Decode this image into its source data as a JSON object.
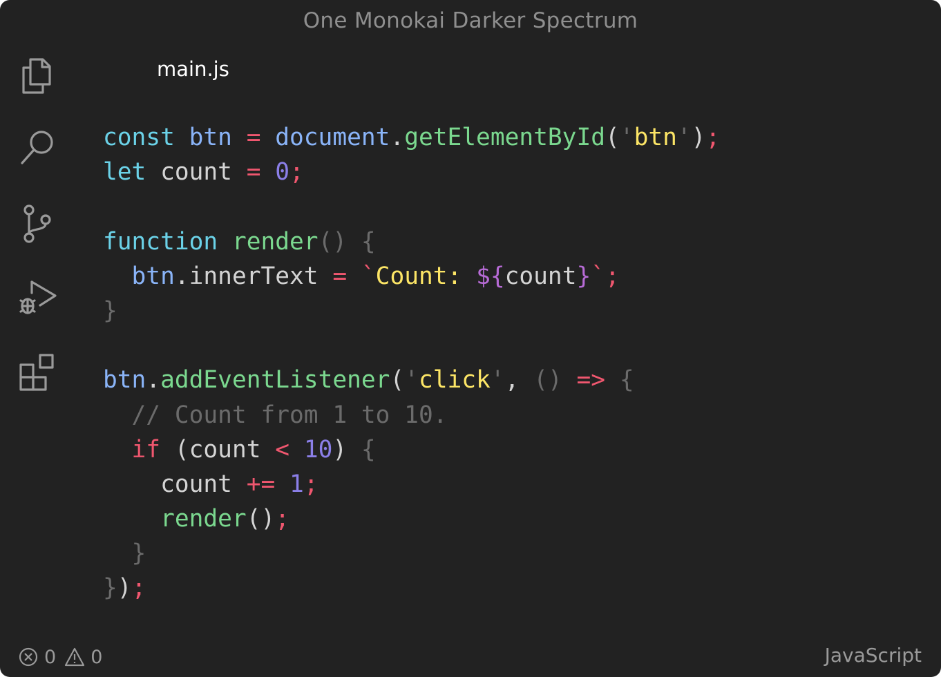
{
  "window": {
    "title": "One Monokai Darker Spectrum"
  },
  "activity_bar": {
    "icons": [
      "files-icon",
      "search-icon",
      "source-control-icon",
      "run-debug-icon",
      "extensions-icon"
    ]
  },
  "tab": {
    "label": "main.js"
  },
  "code": {
    "language": "JavaScript",
    "lines": [
      [
        {
          "t": "const ",
          "c": "kw-b"
        },
        {
          "t": "btn",
          "c": "var"
        },
        {
          "t": " = ",
          "c": "op"
        },
        {
          "t": "document",
          "c": "var"
        },
        {
          "t": ".",
          "c": "pun"
        },
        {
          "t": "getElementById",
          "c": "fn"
        },
        {
          "t": "(",
          "c": "pun"
        },
        {
          "t": "'",
          "c": "gry"
        },
        {
          "t": "btn",
          "c": "str"
        },
        {
          "t": "'",
          "c": "gry"
        },
        {
          "t": ")",
          "c": "pun"
        },
        {
          "t": ";",
          "c": "op"
        }
      ],
      [
        {
          "t": "let ",
          "c": "kw-b"
        },
        {
          "t": "count",
          "c": "plain"
        },
        {
          "t": " = ",
          "c": "op"
        },
        {
          "t": "0",
          "c": "num"
        },
        {
          "t": ";",
          "c": "op"
        }
      ],
      [],
      [
        {
          "t": "function ",
          "c": "kw-b"
        },
        {
          "t": "render",
          "c": "fn"
        },
        {
          "t": "() {",
          "c": "gry"
        }
      ],
      [
        {
          "t": "  btn",
          "c": "var"
        },
        {
          "t": ".",
          "c": "pun"
        },
        {
          "t": "innerText",
          "c": "plain"
        },
        {
          "t": " = ",
          "c": "op"
        },
        {
          "t": "`",
          "c": "op"
        },
        {
          "t": "Count: ",
          "c": "str"
        },
        {
          "t": "${",
          "c": "tpl"
        },
        {
          "t": "count",
          "c": "plain"
        },
        {
          "t": "}",
          "c": "tpl"
        },
        {
          "t": "`",
          "c": "op"
        },
        {
          "t": ";",
          "c": "op"
        }
      ],
      [
        {
          "t": "}",
          "c": "gry"
        }
      ],
      [],
      [
        {
          "t": "btn",
          "c": "var"
        },
        {
          "t": ".",
          "c": "pun"
        },
        {
          "t": "addEventListener",
          "c": "fn"
        },
        {
          "t": "(",
          "c": "pun"
        },
        {
          "t": "'",
          "c": "gry"
        },
        {
          "t": "click",
          "c": "str"
        },
        {
          "t": "'",
          "c": "gry"
        },
        {
          "t": ", ",
          "c": "pun"
        },
        {
          "t": "() ",
          "c": "gry"
        },
        {
          "t": "=>",
          "c": "op"
        },
        {
          "t": " {",
          "c": "gry"
        }
      ],
      [
        {
          "t": "  // Count from 1 to 10.",
          "c": "gry"
        }
      ],
      [
        {
          "t": "  if",
          "c": "kw-r"
        },
        {
          "t": " (count ",
          "c": "plain"
        },
        {
          "t": "<",
          "c": "op"
        },
        {
          "t": " ",
          "c": "plain"
        },
        {
          "t": "10",
          "c": "num"
        },
        {
          "t": ") ",
          "c": "plain"
        },
        {
          "t": "{",
          "c": "gry"
        }
      ],
      [
        {
          "t": "    count ",
          "c": "plain"
        },
        {
          "t": "+=",
          "c": "op"
        },
        {
          "t": " ",
          "c": "plain"
        },
        {
          "t": "1",
          "c": "num"
        },
        {
          "t": ";",
          "c": "op"
        }
      ],
      [
        {
          "t": "    render",
          "c": "fn"
        },
        {
          "t": "()",
          "c": "pun"
        },
        {
          "t": ";",
          "c": "op"
        }
      ],
      [
        {
          "t": "  }",
          "c": "gry"
        }
      ],
      [
        {
          "t": "}",
          "c": "gry"
        },
        {
          "t": ")",
          "c": "pun"
        },
        {
          "t": ";",
          "c": "op"
        }
      ]
    ]
  },
  "status_bar": {
    "errors": "0",
    "warnings": "0",
    "language": "JavaScript"
  }
}
